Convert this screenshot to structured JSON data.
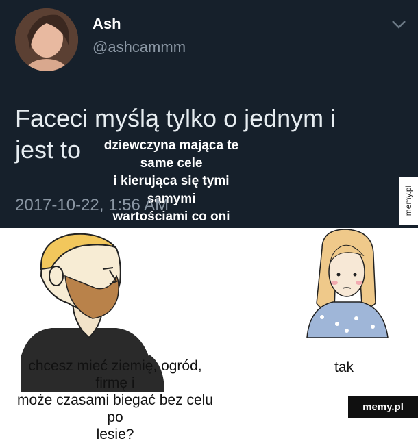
{
  "tweet": {
    "display_name": "Ash",
    "handle": "@ashcammm",
    "text_line1": "Faceci myślą tylko o jednym i",
    "text_line2": "jest to",
    "overlay_line1": "dziewczyna mająca te same cele",
    "overlay_line2": "i kierująca się tymi samymi",
    "overlay_line3": "wartościami co oni",
    "timestamp": "2017-10-22, 1:56 AM"
  },
  "comic": {
    "chad_caption_line1": "chcesz mieć ziemię, ogród, firmę i",
    "chad_caption_line2": "może czasami biegać bez celu po",
    "chad_caption_line3": "lesie?",
    "girl_caption": "tak"
  },
  "watermark": {
    "side": "memy.pl",
    "bottom": "memy.pl"
  },
  "colors": {
    "tweet_background": "#16202b",
    "secondary_text": "#8a96a3"
  }
}
